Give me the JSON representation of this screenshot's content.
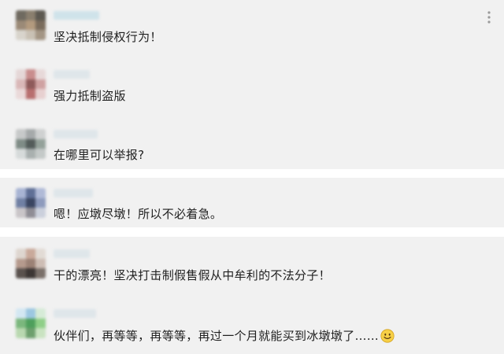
{
  "comments": [
    {
      "text": "坚决抵制侵权行为！"
    },
    {
      "text": "强力抵制盗版"
    },
    {
      "text": "在哪里可以举报?"
    },
    {
      "text": "嗯！应墩尽墩！所以不必着急。"
    },
    {
      "text": "干的漂亮！坚决打击制假售假从中牟利的不法分子！"
    },
    {
      "text": "伙伴们，再等等，再等等，再过一个月就能买到冰墩墩了……"
    }
  ],
  "icons": {
    "more": "more-icon",
    "emoji": "smile-emoji-icon"
  },
  "colors": {
    "panel_bg": "#f1f1f1",
    "separator": "#ffffff",
    "text": "#1f1f1f"
  }
}
